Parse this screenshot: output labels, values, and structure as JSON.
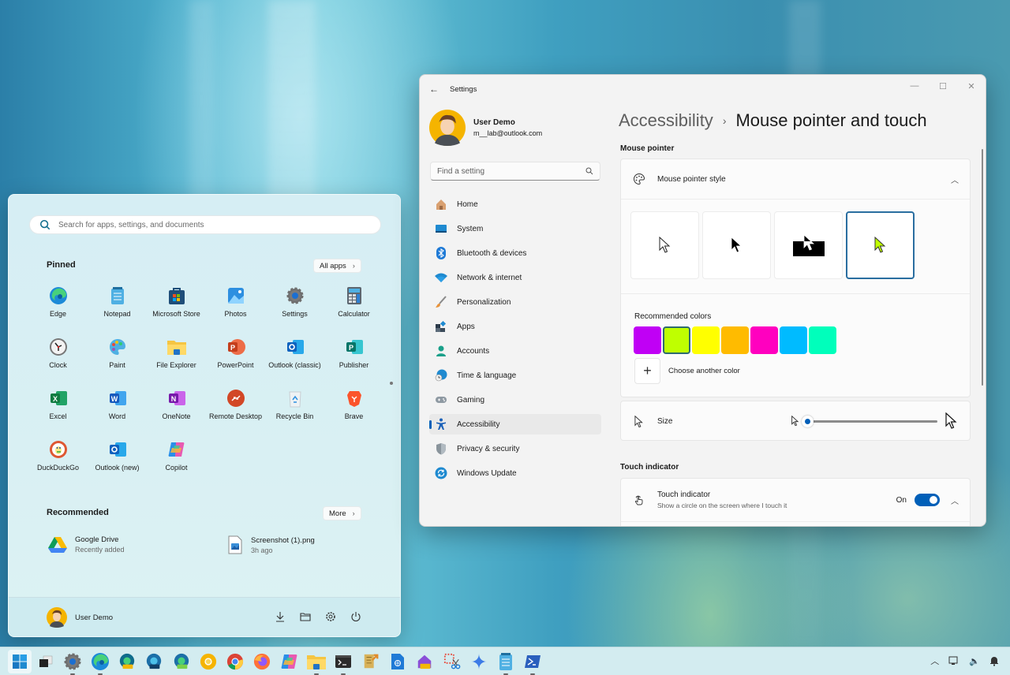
{
  "start_menu": {
    "search_placeholder": "Search for apps, settings, and documents",
    "pinned_title": "Pinned",
    "all_apps_label": "All apps",
    "pinned_apps": [
      {
        "label": "Edge",
        "icon": "edge-icon"
      },
      {
        "label": "Notepad",
        "icon": "notepad-icon"
      },
      {
        "label": "Microsoft Store",
        "icon": "store-icon"
      },
      {
        "label": "Photos",
        "icon": "photos-icon"
      },
      {
        "label": "Settings",
        "icon": "gear-icon"
      },
      {
        "label": "Calculator",
        "icon": "calculator-icon"
      },
      {
        "label": "Clock",
        "icon": "clock-icon"
      },
      {
        "label": "Paint",
        "icon": "paint-icon"
      },
      {
        "label": "File Explorer",
        "icon": "folder-icon"
      },
      {
        "label": "PowerPoint",
        "icon": "powerpoint-icon"
      },
      {
        "label": "Outlook (classic)",
        "icon": "outlook-icon"
      },
      {
        "label": "Publisher",
        "icon": "publisher-icon"
      },
      {
        "label": "Excel",
        "icon": "excel-icon"
      },
      {
        "label": "Word",
        "icon": "word-icon"
      },
      {
        "label": "OneNote",
        "icon": "onenote-icon"
      },
      {
        "label": "Remote Desktop",
        "icon": "remote-desktop-icon"
      },
      {
        "label": "Recycle Bin",
        "icon": "recycle-bin-icon"
      },
      {
        "label": "Brave",
        "icon": "brave-icon"
      },
      {
        "label": "DuckDuckGo",
        "icon": "duckduckgo-icon"
      },
      {
        "label": "Outlook (new)",
        "icon": "outlook-icon"
      },
      {
        "label": "Copilot",
        "icon": "copilot-icon"
      }
    ],
    "recommended_title": "Recommended",
    "more_label": "More",
    "recommended": [
      {
        "title": "Google Drive",
        "subtitle": "Recently added",
        "icon": "google-drive-icon"
      },
      {
        "title": "Screenshot (1).png",
        "subtitle": "3h ago",
        "icon": "image-file-icon"
      }
    ],
    "user_name": "User Demo",
    "footer_icons": [
      "download-icon",
      "folder-icon",
      "gear-icon",
      "power-icon"
    ]
  },
  "settings": {
    "app_title": "Settings",
    "user_name": "User Demo",
    "user_email": "m__lab@outlook.com",
    "search_placeholder": "Find a setting",
    "nav": [
      {
        "label": "Home",
        "icon": "home-icon"
      },
      {
        "label": "System",
        "icon": "system-icon"
      },
      {
        "label": "Bluetooth & devices",
        "icon": "bluetooth-icon"
      },
      {
        "label": "Network & internet",
        "icon": "wifi-icon"
      },
      {
        "label": "Personalization",
        "icon": "brush-icon"
      },
      {
        "label": "Apps",
        "icon": "apps-icon"
      },
      {
        "label": "Accounts",
        "icon": "account-icon"
      },
      {
        "label": "Time & language",
        "icon": "time-language-icon"
      },
      {
        "label": "Gaming",
        "icon": "gamepad-icon"
      },
      {
        "label": "Accessibility",
        "icon": "accessibility-icon",
        "active": true
      },
      {
        "label": "Privacy & security",
        "icon": "shield-icon"
      },
      {
        "label": "Windows Update",
        "icon": "update-icon"
      }
    ],
    "breadcrumb_parent": "Accessibility",
    "breadcrumb_separator": "›",
    "page_title": "Mouse pointer and touch",
    "mouse_pointer_section": "Mouse pointer",
    "pointer_style_label": "Mouse pointer style",
    "pointer_styles": [
      "White",
      "Black",
      "Inverted",
      "Custom"
    ],
    "pointer_style_selected": "Custom",
    "recommended_colors_label": "Recommended colors",
    "recommended_colors": [
      "#c000f5",
      "#bfff00",
      "#ffff00",
      "#ffbb00",
      "#ff00bf",
      "#00bbff",
      "#00ffbb"
    ],
    "selected_color": "#bfff00",
    "choose_color_label": "Choose another color",
    "size_label": "Size",
    "size_value_fraction": 0.0,
    "touch_section": "Touch indicator",
    "touch_indicator_label": "Touch indicator",
    "touch_indicator_desc": "Show a circle on the screen where I touch it",
    "touch_indicator_state": "On",
    "accent_color": "#005fb8"
  },
  "taskbar": {
    "icons": [
      "start-icon",
      "task-view-icon",
      "settings-icon",
      "edge-icon",
      "edge-canary-icon",
      "edge-beta-icon",
      "edge-dev-icon",
      "chrome-canary-icon",
      "chrome-icon",
      "firefox-icon",
      "copilot-icon",
      "file-explorer-icon",
      "terminal-icon",
      "dev-tool-icon",
      "document-icon",
      "home-pre-icon",
      "snipping-tool-icon",
      "gemini-icon",
      "notepad-icon",
      "powershell-icon"
    ],
    "tray_icons": [
      "chevron-up-icon",
      "network-icon",
      "volume-icon",
      "notification-icon"
    ]
  }
}
